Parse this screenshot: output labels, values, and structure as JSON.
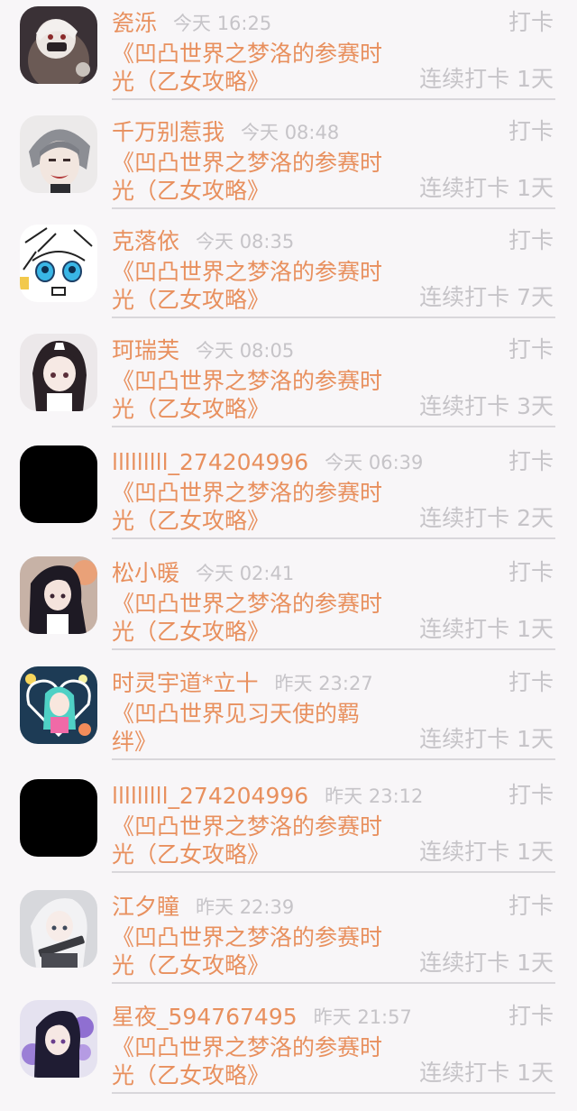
{
  "items": [
    {
      "name": "瓷泺",
      "time": "今天 16:25",
      "checkin": "打卡",
      "topic": "《凹凸世界之梦洛的参赛时光（乙女攻略》",
      "streak": "连续打卡 1天",
      "avatar_icon": "anime-avatar-white-hair-mask"
    },
    {
      "name": "千万别惹我",
      "time": "今天 08:48",
      "checkin": "打卡",
      "topic": "《凹凸世界之梦洛的参赛时光（乙女攻略》",
      "streak": "连续打卡 1天",
      "avatar_icon": "anime-avatar-grey-hair-fangs"
    },
    {
      "name": "克落依",
      "time": "今天 08:35",
      "checkin": "打卡",
      "topic": "《凹凸世界之梦洛的参赛时光（乙女攻略》",
      "streak": "连续打卡 7天",
      "avatar_icon": "sketch-avatar-blue-eyes"
    },
    {
      "name": "珂瑞芙",
      "time": "今天 08:05",
      "checkin": "打卡",
      "topic": "《凹凸世界之梦洛的参赛时光（乙女攻略》",
      "streak": "连续打卡 3天",
      "avatar_icon": "anime-avatar-maid-girl"
    },
    {
      "name": "lllllllll_274204996",
      "time": "今天 06:39",
      "checkin": "打卡",
      "topic": "《凹凸世界之梦洛的参赛时光（乙女攻略》",
      "streak": "连续打卡 2天",
      "avatar_icon": "black-avatar"
    },
    {
      "name": "松小暖",
      "time": "今天 02:41",
      "checkin": "打卡",
      "topic": "《凹凸世界之梦洛的参赛时光（乙女攻略》",
      "streak": "连续打卡 1天",
      "avatar_icon": "anime-avatar-dark-hair-girl"
    },
    {
      "name": "时灵宇道*立十",
      "time": "昨天 23:27",
      "checkin": "打卡",
      "topic": "《凹凸世界见习天使的羁绊》",
      "streak": "连续打卡 1天",
      "avatar_icon": "anime-avatar-heart-teal-hair"
    },
    {
      "name": "lllllllll_274204996",
      "time": "昨天 23:12",
      "checkin": "打卡",
      "topic": "《凹凸世界之梦洛的参赛时光（乙女攻略》",
      "streak": "连续打卡 1天",
      "avatar_icon": "black-avatar"
    },
    {
      "name": "江夕瞳",
      "time": "昨天 22:39",
      "checkin": "打卡",
      "topic": "《凹凸世界之梦洛的参赛时光（乙女攻略》",
      "streak": "连续打卡 1天",
      "avatar_icon": "anime-avatar-white-hair-gun"
    },
    {
      "name": "星夜_594767495",
      "time": "昨天 21:57",
      "checkin": "打卡",
      "topic": "《凹凸世界之梦洛的参赛时光（乙女攻略》",
      "streak": "连续打卡 1天",
      "avatar_icon": "anime-avatar-purple-roses"
    }
  ]
}
